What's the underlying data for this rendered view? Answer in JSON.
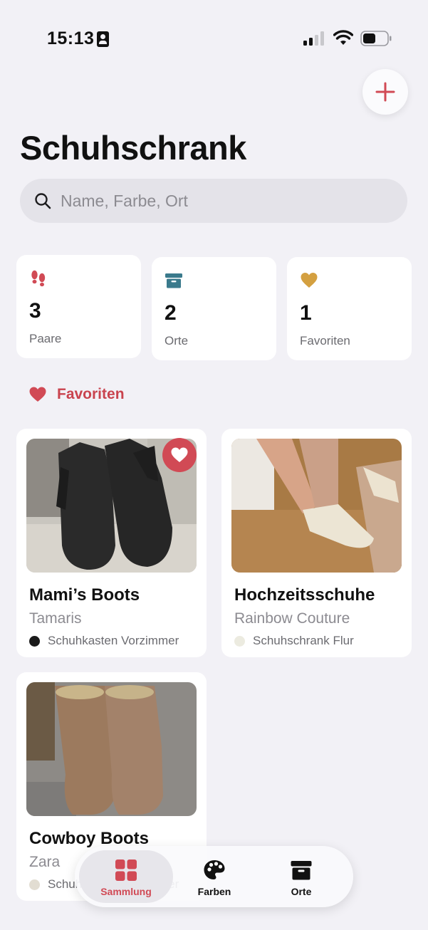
{
  "status_bar": {
    "time": "15:13"
  },
  "header": {
    "title": "Schuhschrank"
  },
  "search": {
    "placeholder": "Name, Farbe, Ort",
    "value": ""
  },
  "stats": [
    {
      "value": "3",
      "label": "Paare",
      "icon": "footprints-icon",
      "color": "#d14a55"
    },
    {
      "value": "2",
      "label": "Orte",
      "icon": "archive-box-icon",
      "color": "#3a7a8c"
    },
    {
      "value": "1",
      "label": "Favoriten",
      "icon": "heart-icon",
      "color": "#d4a040"
    }
  ],
  "favorites_section": {
    "title": "Favoriten",
    "color": "#c9434e"
  },
  "shoes": [
    {
      "name": "Mami’s Boots",
      "brand": "Tamaris",
      "location": "Schuhkasten Vorzimmer",
      "dot_color": "#1a1a1a",
      "favorite": true
    },
    {
      "name": "Hochzeitsschuhe",
      "brand": "Rainbow Couture",
      "location": "Schuhschrank Flur",
      "dot_color": "#ecebe0",
      "favorite": false
    },
    {
      "name": "Cowboy Boots",
      "brand": "Zara",
      "location": "Schuhkasten Vorzimmer",
      "dot_color": "#e2ddd2",
      "favorite": false
    }
  ],
  "tabs": [
    {
      "label": "Sammlung",
      "icon": "grid-icon",
      "active": true
    },
    {
      "label": "Farben",
      "icon": "palette-icon",
      "active": false
    },
    {
      "label": "Orte",
      "icon": "archive-box-icon",
      "active": false
    }
  ],
  "colors": {
    "accent": "#d14a55",
    "background": "#f2f1f6"
  }
}
